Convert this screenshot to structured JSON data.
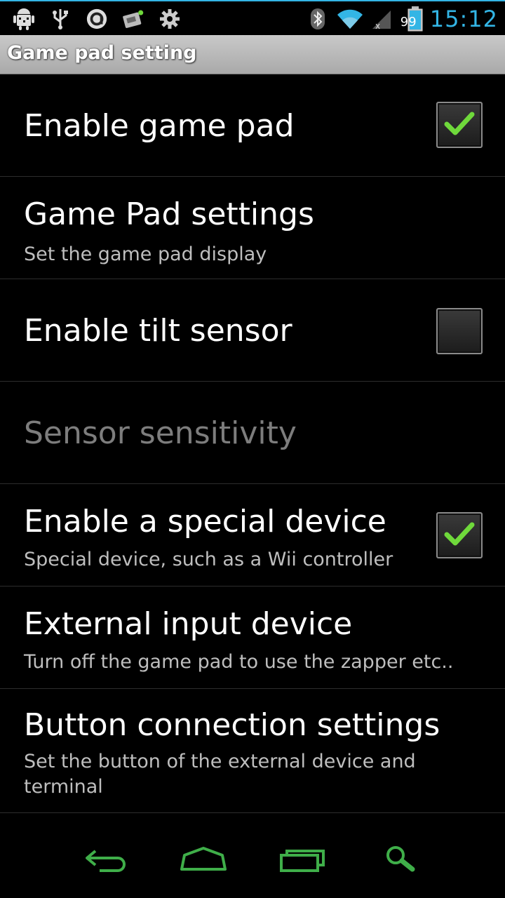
{
  "status_bar": {
    "left_icons": [
      "android-debug-icon",
      "usb-icon",
      "app-notification-icon",
      "sd-card-icon",
      "settings-icon"
    ],
    "right_icons": [
      "bluetooth-icon",
      "wifi-icon",
      "signal-icon",
      "battery-icon"
    ],
    "battery_percent": "99",
    "time": "15:12"
  },
  "title_bar": {
    "title": "Game pad setting"
  },
  "preferences": [
    {
      "title": "Enable game pad",
      "summary": "",
      "checkbox": true,
      "checked": true,
      "enabled": true
    },
    {
      "title": "Game Pad settings",
      "summary": "Set the game pad display",
      "checkbox": false,
      "enabled": true
    },
    {
      "title": "Enable tilt sensor",
      "summary": "",
      "checkbox": true,
      "checked": false,
      "enabled": true
    },
    {
      "title": "Sensor sensitivity",
      "summary": "",
      "checkbox": false,
      "enabled": false
    },
    {
      "title": "Enable a special device",
      "summary": "Special device, such as a Wii controller",
      "checkbox": true,
      "checked": true,
      "enabled": true
    },
    {
      "title": "External input device",
      "summary": "Turn off the game pad to use the zapper etc..",
      "checkbox": false,
      "enabled": true
    },
    {
      "title": "Button connection settings",
      "summary": "Set the button of the external device and terminal",
      "checkbox": false,
      "enabled": true
    }
  ],
  "nav_bar": {
    "buttons": [
      "back-icon",
      "home-icon",
      "recent-apps-icon",
      "search-icon"
    ],
    "color": "#3fae49"
  },
  "colors": {
    "accent": "#33b5e5",
    "check": "#6fd93b",
    "nav": "#3fae49"
  }
}
